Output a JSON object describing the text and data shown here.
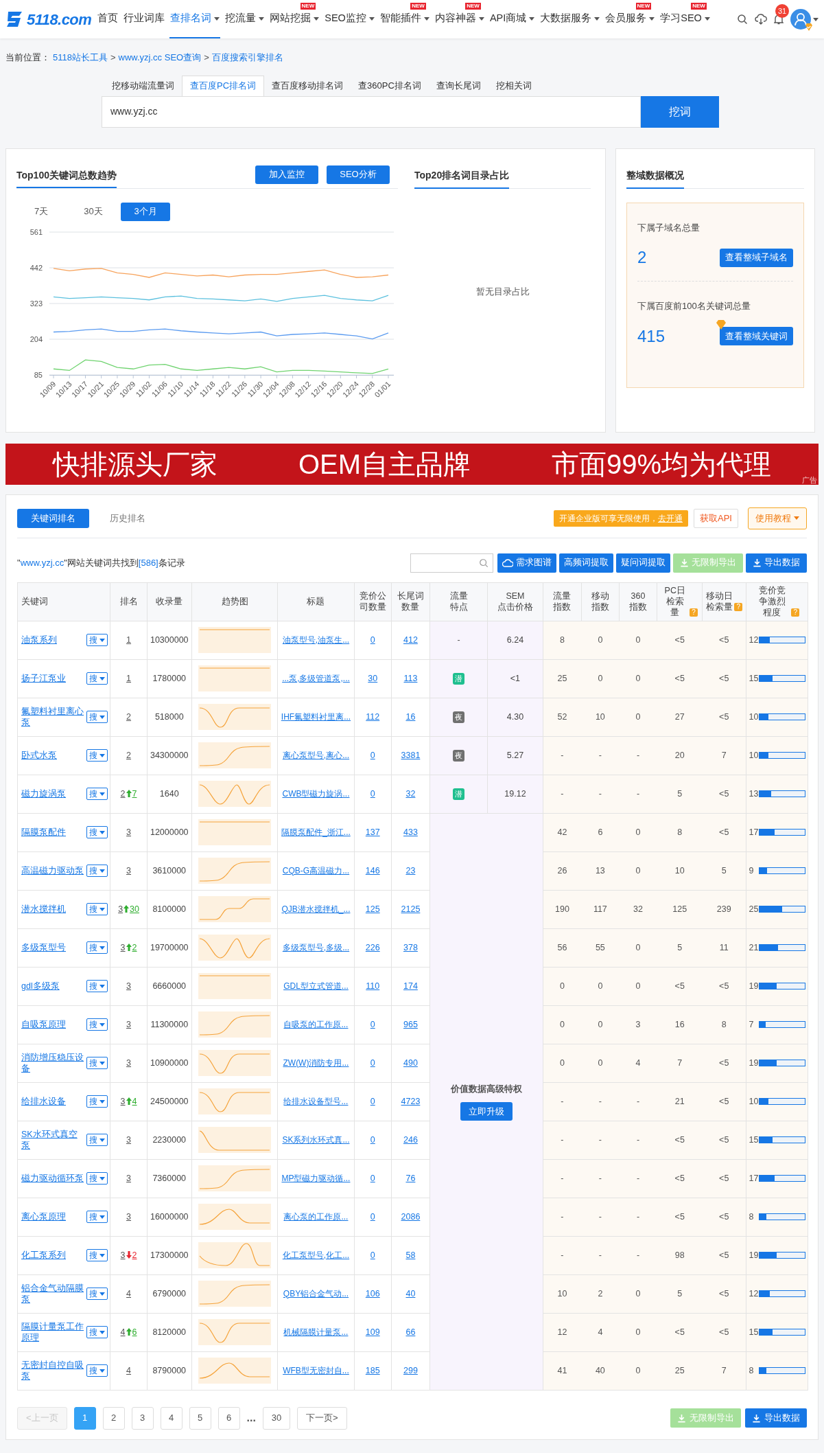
{
  "nav": {
    "logo": "5118.com",
    "items": [
      {
        "label": "首页",
        "selected": false,
        "caret": false
      },
      {
        "label": "行业词库",
        "selected": false,
        "caret": false
      },
      {
        "label": "查排名词",
        "selected": true,
        "caret": true
      },
      {
        "label": "挖流量",
        "selected": false,
        "caret": true
      },
      {
        "label": "网站挖掘",
        "selected": false,
        "caret": true,
        "badge": "NEW"
      },
      {
        "label": "SEO监控",
        "selected": false,
        "caret": true
      },
      {
        "label": "智能插件",
        "selected": false,
        "caret": true,
        "badge": "NEW"
      },
      {
        "label": "内容神器",
        "selected": false,
        "caret": true,
        "badge": "NEW"
      },
      {
        "label": "API商城",
        "selected": false,
        "caret": true
      },
      {
        "label": "大数据服务",
        "selected": false,
        "caret": true
      },
      {
        "label": "会员服务",
        "selected": false,
        "caret": true,
        "badge": "NEW"
      },
      {
        "label": "学习SEO",
        "selected": false,
        "caret": true,
        "badge": "NEW"
      }
    ],
    "notification_count": "31"
  },
  "breadcrumb": {
    "label": "当前位置：",
    "items": [
      {
        "text": "5118站长工具"
      },
      {
        "separator": ">",
        "text": "www.yzj.cc SEO查询"
      },
      {
        "separator": ">",
        "text": "百度搜索引擎排名"
      }
    ]
  },
  "search_tabs": [
    {
      "label": "挖移动端流量词",
      "selected": false
    },
    {
      "label": "查百度PC排名词",
      "selected": true
    },
    {
      "label": "查百度移动排名词",
      "selected": false
    },
    {
      "label": "查360PC排名词",
      "selected": false
    },
    {
      "label": "查询长尾词",
      "selected": false
    },
    {
      "label": "挖相关词",
      "selected": false
    }
  ],
  "search": {
    "value": "www.yzj.cc",
    "button": "挖词"
  },
  "trend_panel": {
    "title": "Top100关键词总数趋势",
    "buttons": [
      "加入监控",
      "SEO分析"
    ],
    "ranges": [
      {
        "label": "7天",
        "selected": false
      },
      {
        "label": "30天",
        "selected": false
      },
      {
        "label": "3个月",
        "selected": true
      }
    ],
    "chart_data": {
      "type": "line",
      "grid": true,
      "categories": [
        "10/09",
        "10/13",
        "10/17",
        "10/21",
        "10/25",
        "10/29",
        "11/02",
        "11/06",
        "11/10",
        "11/14",
        "11/18",
        "11/22",
        "11/26",
        "11/30",
        "12/04",
        "12/08",
        "12/12",
        "12/16",
        "12/20",
        "12/24",
        "12/28",
        "01/01"
      ],
      "ylim": [
        85,
        561
      ],
      "yticks": [
        85,
        204,
        323,
        442,
        561
      ],
      "series": [
        {
          "color": "#f7a35c",
          "values": [
            440,
            432,
            438,
            440,
            425,
            420,
            410,
            425,
            420,
            415,
            418,
            412,
            418,
            420,
            420,
            425,
            430,
            435,
            420,
            410,
            412,
            418
          ]
        },
        {
          "color": "#5bc0de",
          "values": [
            345,
            340,
            342,
            345,
            342,
            340,
            335,
            345,
            348,
            340,
            338,
            335,
            332,
            338,
            330,
            340,
            345,
            350,
            340,
            335,
            332,
            350
          ]
        },
        {
          "color": "#5b9bf0",
          "values": [
            228,
            230,
            235,
            238,
            230,
            230,
            235,
            238,
            232,
            228,
            225,
            222,
            225,
            228,
            215,
            220,
            222,
            225,
            220,
            215,
            205,
            225
          ]
        },
        {
          "color": "#6fd36f",
          "values": [
            105,
            100,
            135,
            130,
            110,
            105,
            118,
            120,
            105,
            100,
            105,
            110,
            105,
            112,
            95,
            100,
            100,
            98,
            95,
            92,
            90,
            105
          ]
        }
      ]
    }
  },
  "directory_panel": {
    "title": "Top20排名词目录占比",
    "empty": "暂无目录占比"
  },
  "domain_panel": {
    "title": "整域数据概况",
    "stats": [
      {
        "label": "下属子域名总量",
        "value": "2",
        "button": "查看整域子域名",
        "vip": false
      },
      {
        "label": "下属百度前100名关键词总量",
        "value": "415",
        "button": "查看整域关键词",
        "vip": true
      }
    ]
  },
  "banner": {
    "texts": [
      "快排源头厂家",
      "OEM自主品牌",
      "市面99%均为代理"
    ],
    "ad": "广告"
  },
  "results": {
    "tabs": [
      {
        "label": "关键词排名",
        "selected": true
      },
      {
        "label": "历史排名",
        "selected": false
      }
    ],
    "promo": {
      "text": "开通企业版可享无限使用，",
      "link": "去开通"
    },
    "api_button": "获取API",
    "tutorial_button": "使用教程",
    "record": {
      "prefix": "\"",
      "domain": "www.yzj.cc",
      "middle": "\"网站关键词共找到",
      "count": "[586]",
      "suffix": "条记录"
    },
    "tools": [
      {
        "label": "需求图谱",
        "kind": "graph",
        "disabled": false
      },
      {
        "label": "高频词提取",
        "kind": "plain",
        "disabled": false
      },
      {
        "label": "疑问词提取",
        "kind": "plain",
        "disabled": false
      },
      {
        "label": "无限制导出",
        "kind": "download",
        "disabled": true
      },
      {
        "label": "导出数据",
        "kind": "download",
        "disabled": false
      }
    ],
    "columns": [
      {
        "label": "关键词"
      },
      {
        "label": "排名"
      },
      {
        "label": "收录量"
      },
      {
        "label": "趋势图"
      },
      {
        "label": "标题"
      },
      {
        "label": "竞价公司数量"
      },
      {
        "label": "长尾词数量"
      },
      {
        "label": "流量特点"
      },
      {
        "label": "SEM\n点击价格"
      },
      {
        "label": "流量指数"
      },
      {
        "label": "移动指数"
      },
      {
        "label": "360\n指数"
      },
      {
        "label": "PC日检索量",
        "help": "?"
      },
      {
        "label": "移动日检索量",
        "help": "?"
      },
      {
        "label": "竞价竞争激烈程度",
        "help": "?"
      }
    ],
    "locked": {
      "text": "价值数据高级特权",
      "button": "立即升级"
    },
    "rows": [
      {
        "keyword": "油泵系列",
        "search_button": "搜",
        "rank": "1",
        "indexed": "10300000",
        "sparkline": {
          "kind": "flat"
        },
        "title": "油泵型号,油泵生...",
        "bid": "0",
        "longtail": "412",
        "traffic": {
          "text": "-"
        },
        "sem": "6.24",
        "stats": [
          "8",
          "0",
          "0",
          "<5",
          "<5"
        ],
        "competition": {
          "value": "12",
          "level": 0.24
        }
      },
      {
        "keyword": "扬子江泵业",
        "search_button": "搜",
        "rank": "1",
        "indexed": "1780000",
        "sparkline": {
          "kind": "flat"
        },
        "title": "...泵,多级管道泵,...",
        "bid": "30",
        "longtail": "113",
        "traffic": {
          "text": "潜",
          "color": "#1fbf8f"
        },
        "sem": "<1",
        "stats": [
          "25",
          "0",
          "0",
          "<5",
          "<5"
        ],
        "competition": {
          "value": "15",
          "level": 0.3
        }
      },
      {
        "keyword": "氟塑料衬里离心泵",
        "search_button": "搜",
        "rank": "2",
        "indexed": "518000",
        "sparkline": {
          "kind": "dip"
        },
        "title": "IHF氟塑料衬里离...",
        "bid": "112",
        "longtail": "16",
        "traffic": {
          "text": "夜",
          "color": "#707070"
        },
        "sem": "4.30",
        "stats": [
          "52",
          "10",
          "0",
          "27",
          "<5"
        ],
        "competition": {
          "value": "10",
          "level": 0.2
        }
      },
      {
        "keyword": "卧式水泵",
        "search_button": "搜",
        "rank": "2",
        "indexed": "34300000",
        "sparkline": {
          "kind": "rise"
        },
        "title": "离心泵型号,离心...",
        "bid": "0",
        "longtail": "3381",
        "traffic": {
          "text": "夜",
          "color": "#707070"
        },
        "sem": "5.27",
        "stats": [
          "-",
          "-",
          "-",
          "20",
          "7"
        ],
        "competition": {
          "value": "10",
          "level": 0.2
        }
      },
      {
        "keyword": "磁力旋涡泵",
        "search_button": "搜",
        "rank": "2",
        "change": {
          "kind": "up",
          "amount": "7"
        },
        "indexed": "1640",
        "sparkline": {
          "kind": "wave"
        },
        "title": "CWB型磁力旋涡...",
        "bid": "0",
        "longtail": "32",
        "traffic": {
          "text": "潜",
          "color": "#1fbf8f"
        },
        "sem": "19.12",
        "stats": [
          "-",
          "-",
          "-",
          "5",
          "<5"
        ],
        "competition": {
          "value": "13",
          "level": 0.26
        }
      },
      {
        "keyword": "隔膜泵配件",
        "search_button": "搜",
        "rank": "3",
        "indexed": "12000000",
        "sparkline": {
          "kind": "flat"
        },
        "title": "隔膜泵配件_浙江...",
        "bid": "137",
        "longtail": "433",
        "stats": [
          "42",
          "6",
          "0",
          "8",
          "<5"
        ],
        "competition": {
          "value": "17",
          "level": 0.34
        }
      },
      {
        "keyword": "高温磁力驱动泵",
        "search_button": "搜",
        "rank": "3",
        "indexed": "3610000",
        "sparkline": {
          "kind": "rise"
        },
        "title": "CQB-G高温磁力...",
        "bid": "146",
        "longtail": "23",
        "stats": [
          "26",
          "13",
          "0",
          "10",
          "5"
        ],
        "competition": {
          "value": "9",
          "level": 0.18
        }
      },
      {
        "keyword": "潜水搅拌机",
        "search_button": "搜",
        "rank": "3",
        "change": {
          "kind": "up",
          "amount": "30"
        },
        "indexed": "8100000",
        "sparkline": {
          "kind": "steps"
        },
        "title": "QJB潜水搅拌机_...",
        "bid": "125",
        "longtail": "2125",
        "stats": [
          "190",
          "117",
          "32",
          "125",
          "239"
        ],
        "competition": {
          "value": "25",
          "level": 0.5
        }
      },
      {
        "keyword": "多级泵型号",
        "search_button": "搜",
        "rank": "3",
        "change": {
          "kind": "up",
          "amount": "2"
        },
        "indexed": "19700000",
        "sparkline": {
          "kind": "wave"
        },
        "title": "多级泵型号,多级...",
        "bid": "226",
        "longtail": "378",
        "stats": [
          "56",
          "55",
          "0",
          "5",
          "11"
        ],
        "competition": {
          "value": "21",
          "level": 0.42
        }
      },
      {
        "keyword": "gdl多级泵",
        "search_button": "搜",
        "rank": "3",
        "indexed": "6660000",
        "sparkline": {
          "kind": "flat"
        },
        "title": "GDL型立式管道...",
        "bid": "110",
        "longtail": "174",
        "stats": [
          "0",
          "0",
          "0",
          "<5",
          "<5"
        ],
        "competition": {
          "value": "19",
          "level": 0.38
        }
      },
      {
        "keyword": "自吸泵原理",
        "search_button": "搜",
        "rank": "3",
        "indexed": "11300000",
        "sparkline": {
          "kind": "rise"
        },
        "title": "自吸泵的工作原...",
        "bid": "0",
        "longtail": "965",
        "stats": [
          "0",
          "0",
          "3",
          "16",
          "8"
        ],
        "competition": {
          "value": "7",
          "level": 0.14
        }
      },
      {
        "keyword": "消防增压稳压设备",
        "search_button": "搜",
        "rank": "3",
        "indexed": "10900000",
        "sparkline": {
          "kind": "dip"
        },
        "title": "ZW(W)消防专用...",
        "bid": "0",
        "longtail": "490",
        "stats": [
          "0",
          "0",
          "4",
          "7",
          "<5"
        ],
        "competition": {
          "value": "19",
          "level": 0.38
        }
      },
      {
        "keyword": "给排水设备",
        "search_button": "搜",
        "rank": "3",
        "change": {
          "kind": "up",
          "amount": "4"
        },
        "indexed": "24500000",
        "sparkline": {
          "kind": "dip"
        },
        "title": "给排水设备型号...",
        "bid": "0",
        "longtail": "4723",
        "stats": [
          "-",
          "-",
          "-",
          "21",
          "<5"
        ],
        "competition": {
          "value": "10",
          "level": 0.2
        }
      },
      {
        "keyword": "SK水环式真空泵",
        "search_button": "搜",
        "rank": "3",
        "indexed": "2230000",
        "sparkline": {
          "kind": "fall"
        },
        "title": "SK系列水环式真...",
        "bid": "0",
        "longtail": "246",
        "stats": [
          "-",
          "-",
          "-",
          "<5",
          "<5"
        ],
        "competition": {
          "value": "15",
          "level": 0.3
        }
      },
      {
        "keyword": "磁力驱动循环泵",
        "search_button": "搜",
        "rank": "3",
        "indexed": "7360000",
        "sparkline": {
          "kind": "rise"
        },
        "title": "MP型磁力驱动循...",
        "bid": "0",
        "longtail": "76",
        "stats": [
          "-",
          "-",
          "-",
          "<5",
          "<5"
        ],
        "competition": {
          "value": "17",
          "level": 0.34
        }
      },
      {
        "keyword": "离心泵原理",
        "search_button": "搜",
        "rank": "3",
        "indexed": "16000000",
        "sparkline": {
          "kind": "hump"
        },
        "title": "离心泵的工作原...",
        "bid": "0",
        "longtail": "2086",
        "stats": [
          "-",
          "-",
          "-",
          "<5",
          "<5"
        ],
        "competition": {
          "value": "8",
          "level": 0.16
        }
      },
      {
        "keyword": "化工泵系列",
        "search_button": "搜",
        "rank": "3",
        "change": {
          "kind": "down",
          "amount": "2"
        },
        "indexed": "17300000",
        "sparkline": {
          "kind": "spike"
        },
        "title": "化工泵型号,化工...",
        "bid": "0",
        "longtail": "58",
        "stats": [
          "-",
          "-",
          "-",
          "98",
          "<5"
        ],
        "competition": {
          "value": "19",
          "level": 0.38
        }
      },
      {
        "keyword": "铝合金气动隔膜泵",
        "search_button": "搜",
        "rank": "4",
        "indexed": "6790000",
        "sparkline": {
          "kind": "rise"
        },
        "title": "QBY铝合金气动...",
        "bid": "106",
        "longtail": "40",
        "stats": [
          "10",
          "2",
          "0",
          "5",
          "<5"
        ],
        "competition": {
          "value": "12",
          "level": 0.24
        }
      },
      {
        "keyword": "隔膜计量泵工作原理",
        "search_button": "搜",
        "rank": "4",
        "change": {
          "kind": "up",
          "amount": "6"
        },
        "indexed": "8120000",
        "sparkline": {
          "kind": "dip"
        },
        "title": "机械隔膜计量泵...",
        "bid": "109",
        "longtail": "66",
        "stats": [
          "12",
          "4",
          "0",
          "<5",
          "<5"
        ],
        "competition": {
          "value": "15",
          "level": 0.3
        }
      },
      {
        "keyword": "无密封自控自吸泵",
        "search_button": "搜",
        "rank": "4",
        "indexed": "8790000",
        "sparkline": {
          "kind": "hump"
        },
        "title": "WFB型无密封自...",
        "bid": "185",
        "longtail": "299",
        "stats": [
          "41",
          "40",
          "0",
          "25",
          "7"
        ],
        "competition": {
          "value": "8",
          "level": 0.16
        }
      }
    ],
    "pagination": {
      "prev": {
        "label": "<上一页",
        "disabled": true
      },
      "pages": [
        {
          "label": "1",
          "selected": true
        },
        {
          "label": "2",
          "selected": false
        },
        {
          "label": "3",
          "selected": false
        },
        {
          "label": "4",
          "selected": false
        },
        {
          "label": "5",
          "selected": false
        },
        {
          "label": "6",
          "selected": false
        }
      ],
      "ellipsis": "...",
      "last": {
        "label": "30",
        "selected": false
      },
      "next": {
        "label": "下一页>",
        "disabled": false
      }
    },
    "bottom_tools": [
      {
        "label": "无限制导出",
        "disabled": true
      },
      {
        "label": "导出数据",
        "disabled": false
      }
    ]
  }
}
